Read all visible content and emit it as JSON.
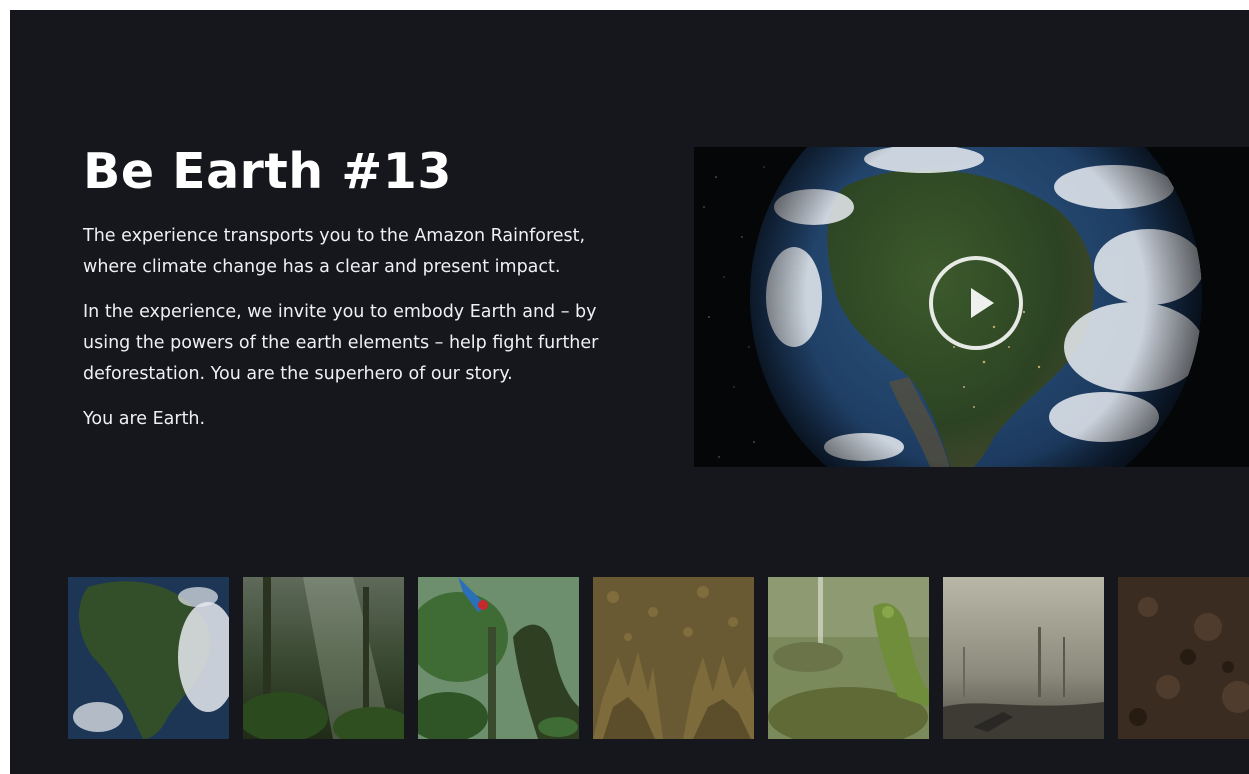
{
  "experience": {
    "title": "Be Earth #13",
    "paragraphs": [
      "The experience transports you to the Amazon Rainforest, where climate change has a clear and present impact.",
      "In the experience, we invite you to embody Earth and – by using the powers of the earth elements – help fight further deforestation. You are the superhero of our story.",
      "You are Earth."
    ]
  },
  "video": {
    "thumbnail": "earth-from-space-south-america",
    "control_icon": "play-icon"
  },
  "gallery": {
    "items": [
      {
        "depicts": "earth-from-space"
      },
      {
        "depicts": "misty-rainforest-sunbeams"
      },
      {
        "depicts": "parrot-and-raised-hand"
      },
      {
        "depicts": "root-like-hands"
      },
      {
        "depicts": "mossy-hand-raised"
      },
      {
        "depicts": "smoky-deforested-land"
      },
      {
        "depicts": "dark-soil-ground"
      }
    ]
  },
  "colors": {
    "background": "#16171d",
    "text": "#ffffff"
  }
}
